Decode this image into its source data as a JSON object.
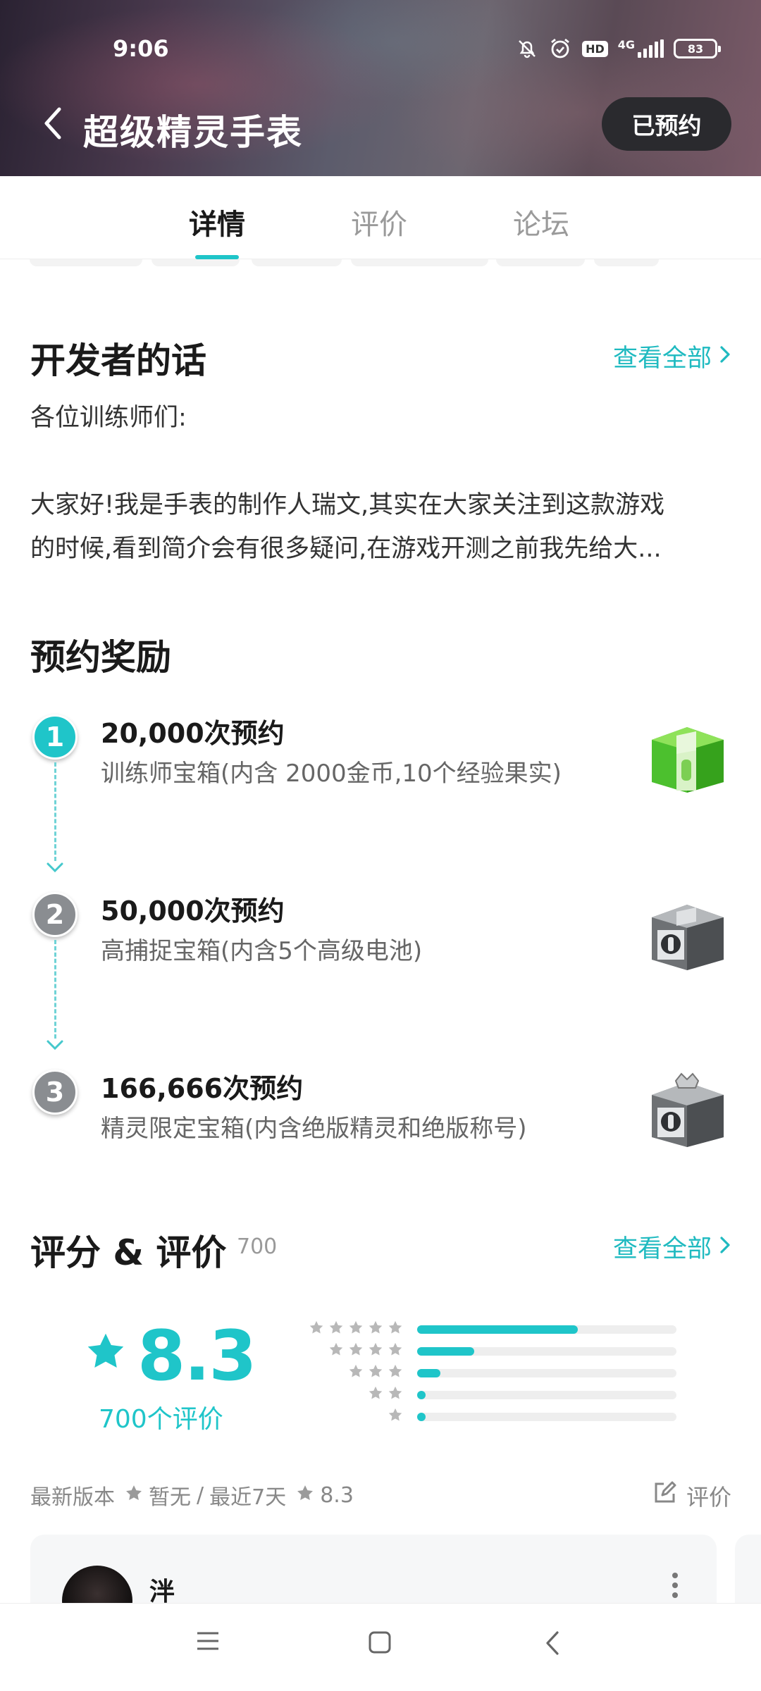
{
  "status_bar": {
    "time": "9:06",
    "net_label": "4G",
    "hd_label": "HD",
    "battery": "83",
    "icons": [
      "bell-off-icon",
      "alarm-icon",
      "hd-icon",
      "signal-icon",
      "battery-icon"
    ]
  },
  "header": {
    "title": "超级精灵手表",
    "action_label": "已预约"
  },
  "tabs": [
    {
      "label": "详情",
      "active": true
    },
    {
      "label": "评价",
      "active": false
    },
    {
      "label": "论坛",
      "active": false
    }
  ],
  "developer_note": {
    "title": "开发者的话",
    "view_all": "查看全部",
    "greeting": "各位训练师们:",
    "line1": "大家好!我是手表的制作人瑞文,其实在大家关注到这款游戏",
    "line2": "的时候,看到简介会有很多疑问,在游戏开测之前我先给大..."
  },
  "rewards": {
    "title": "预约奖励",
    "items": [
      {
        "index": "1",
        "title": "20,000次预约",
        "desc": "训练师宝箱(内含 2000金币,10个经验果实)",
        "chest": "green"
      },
      {
        "index": "2",
        "title": "50,000次预约",
        "desc": "高捕捉宝箱(内含5个高级电池)",
        "chest": "gray"
      },
      {
        "index": "3",
        "title": "166,666次预约",
        "desc": "精灵限定宝箱(内含绝版精灵和绝版称号)",
        "chest": "gray-crown"
      }
    ]
  },
  "ratings": {
    "title": "评分 & 评价",
    "count": "700",
    "view_all": "查看全部",
    "score": "8.3",
    "total_label": "700个评价",
    "distribution": [
      {
        "stars": 5,
        "fraction": 0.62
      },
      {
        "stars": 4,
        "fraction": 0.22
      },
      {
        "stars": 3,
        "fraction": 0.09
      },
      {
        "stars": 2,
        "fraction": 0.03
      },
      {
        "stars": 1,
        "fraction": 0.03
      }
    ],
    "meta": {
      "latest_label": "最新版本",
      "latest_value": "暂无",
      "separator": "/",
      "recent_label": "最近7天",
      "recent_value": "8.3"
    },
    "write_label": "评价"
  },
  "review": {
    "author": "泮"
  },
  "colors": {
    "accent": "#1fc5c9",
    "dark_button": "#2a2a2e"
  }
}
